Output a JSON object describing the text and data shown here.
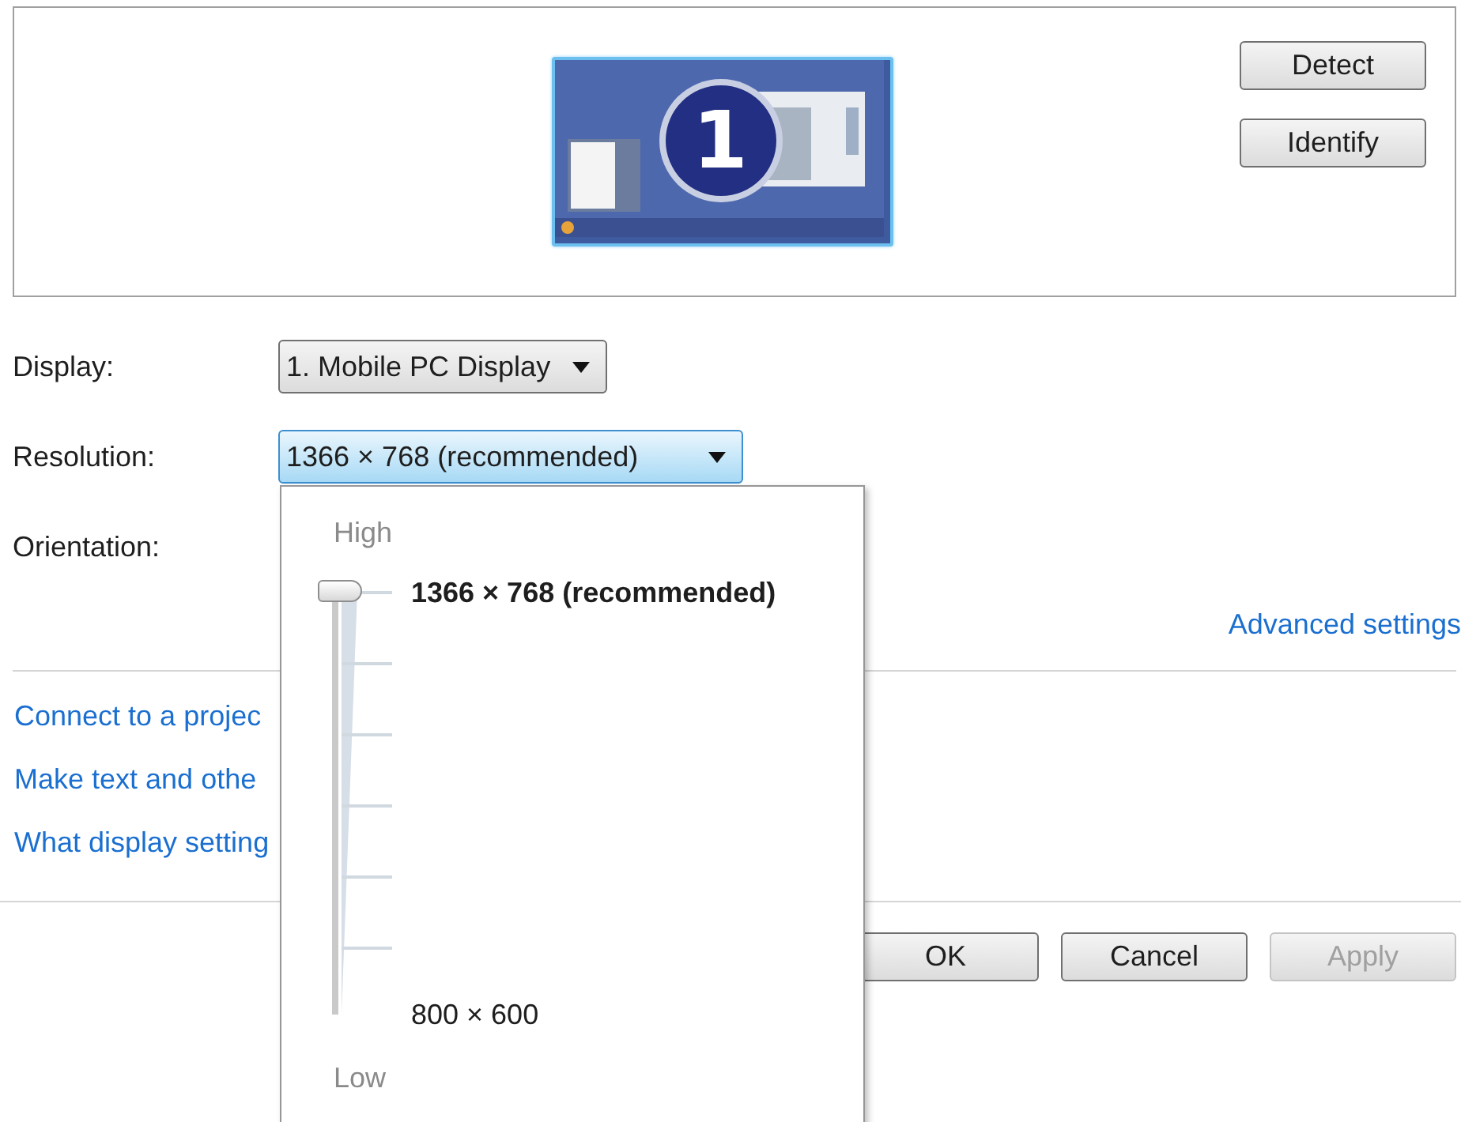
{
  "preview": {
    "monitor_number": "1",
    "buttons": [
      {
        "label": "Detect"
      },
      {
        "label": "Identify"
      }
    ]
  },
  "settings": [
    {
      "label": "Display:",
      "value": "1. Mobile PC Display",
      "open": false
    },
    {
      "label": "Resolution:",
      "value": "1366 × 768 (recommended)",
      "open": true
    },
    {
      "label": "Orientation:"
    }
  ],
  "advanced_link": "Advanced settings",
  "links": [
    "Connect to a projec",
    "Make text and othe",
    "What display setting"
  ],
  "buttons": [
    {
      "label": "OK",
      "disabled": false
    },
    {
      "label": "Cancel",
      "disabled": false
    },
    {
      "label": "Apply",
      "disabled": true
    }
  ],
  "resolution_popup": {
    "high_label": "High",
    "low_label": "Low",
    "top_option": "1366 × 768 (recommended)",
    "bottom_option": "800 × 600"
  }
}
